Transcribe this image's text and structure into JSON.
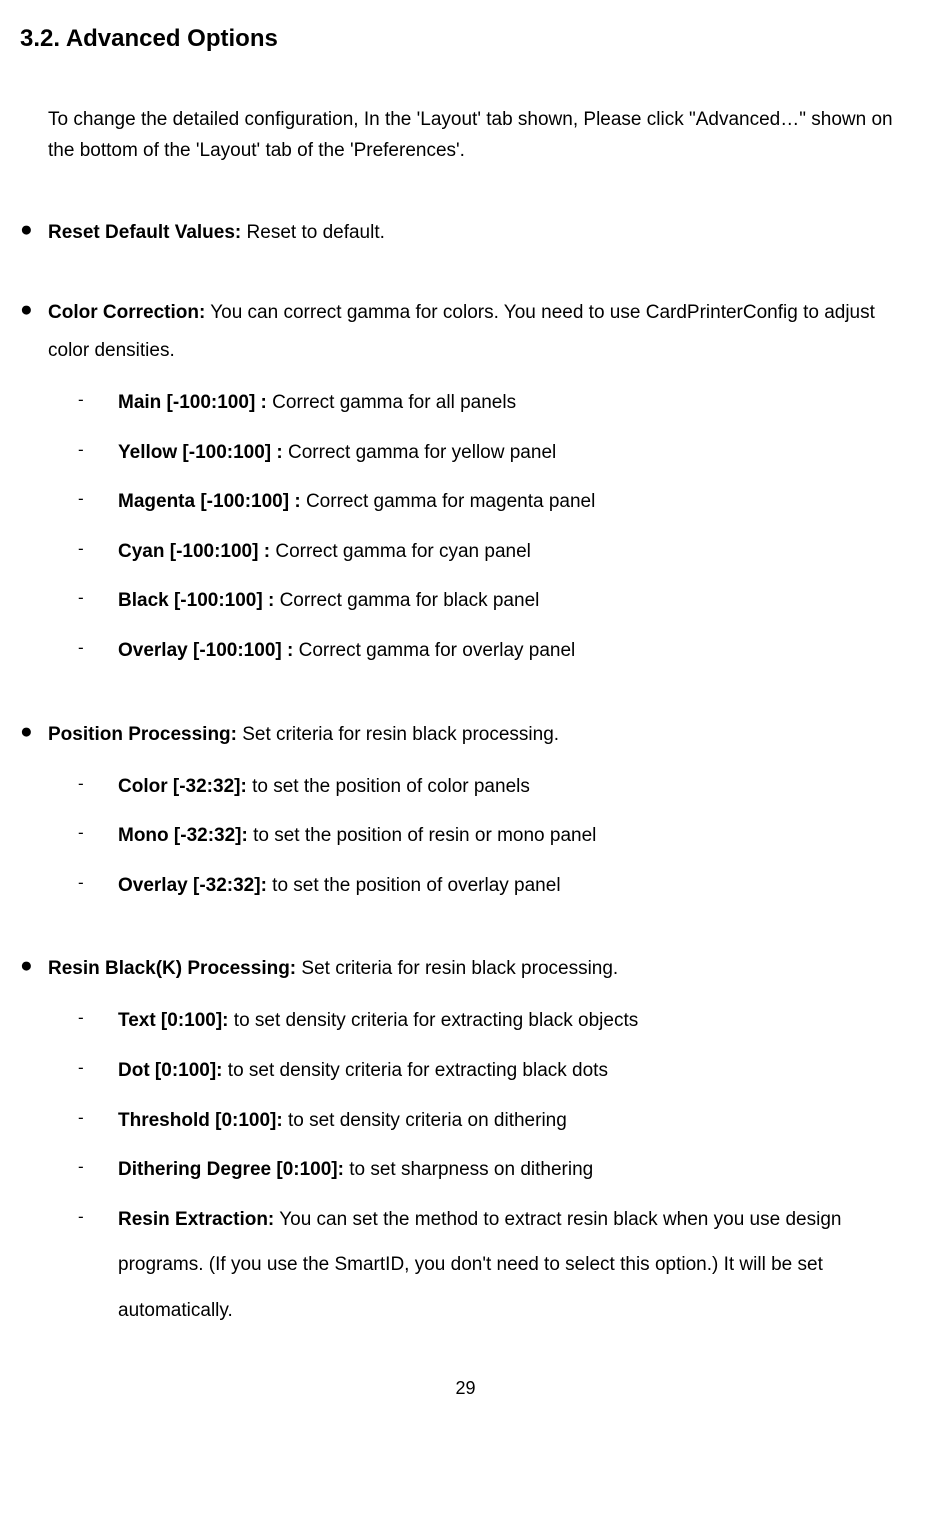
{
  "section": {
    "number": "3.2.",
    "title": "Advanced Options"
  },
  "intro": "To change the detailed configuration, In the 'Layout' tab shown, Please click \"Advanced…\" shown on the bottom of the 'Layout' tab of the 'Preferences'.",
  "bullets": [
    {
      "title": "Reset Default Values:",
      "desc": " Reset to default.",
      "items": []
    },
    {
      "title": "Color Correction:",
      "desc": " You can correct gamma for colors. You need to use CardPrinterConfig to adjust color densities.",
      "items": [
        {
          "title": "Main [-100:100] :",
          "desc": " Correct gamma for all panels"
        },
        {
          "title": "Yellow [-100:100] :",
          "desc": " Correct gamma for yellow panel"
        },
        {
          "title": "Magenta [-100:100] :",
          "desc": " Correct gamma for magenta panel"
        },
        {
          "title": "Cyan [-100:100] :",
          "desc": " Correct gamma for cyan panel"
        },
        {
          "title": "Black [-100:100] :",
          "desc": " Correct gamma for black panel"
        },
        {
          "title": "Overlay [-100:100] :",
          "desc": " Correct gamma for overlay panel"
        }
      ]
    },
    {
      "title": "Position Processing:",
      "desc": " Set criteria for resin black processing.",
      "items": [
        {
          "title": "Color [-32:32]:",
          "desc": " to set the position of color panels"
        },
        {
          "title": "Mono [-32:32]:",
          "desc": " to set the position of resin or mono panel"
        },
        {
          "title": "Overlay [-32:32]:",
          "desc": " to set the position of overlay panel"
        }
      ]
    },
    {
      "title": "Resin Black(K) Processing:",
      "desc": " Set criteria for resin black processing.",
      "items": [
        {
          "title": "Text [0:100]:",
          "desc": " to set density criteria for extracting black objects"
        },
        {
          "title": "Dot [0:100]:",
          "desc": " to set density criteria for extracting black dots"
        },
        {
          "title": "Threshold [0:100]:",
          "desc": " to set density criteria on dithering"
        },
        {
          "title": "Dithering Degree [0:100]:",
          "desc": " to set sharpness on dithering"
        },
        {
          "title": "Resin Extraction:",
          "desc": " You can set the method to extract resin black when you use design programs. (If you use the SmartID, you don't need to select this option.) It will be set automatically."
        }
      ]
    }
  ],
  "pageNumber": "29"
}
